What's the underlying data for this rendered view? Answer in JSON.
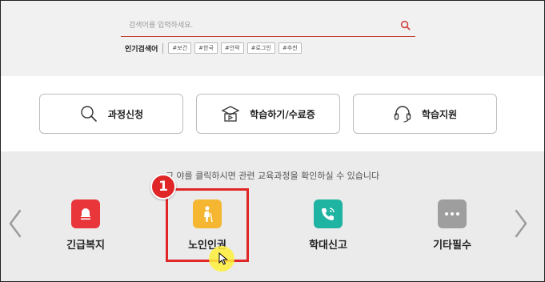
{
  "search": {
    "placeholder": "검색어를 입력하세요.",
    "popular_label": "인기검색어",
    "tags": [
      "#보건",
      "#한국",
      "#안락",
      "#로그인",
      "#추천"
    ]
  },
  "quick_menu": [
    {
      "label": "과정신청",
      "icon": "search-icon"
    },
    {
      "label": "학습하기/수료증",
      "icon": "graduation-icon"
    },
    {
      "label": "학습지원",
      "icon": "headset-icon"
    }
  ],
  "categories": {
    "note": "고 야를 클릭하시면 관련 교육과정을 확인하실 수 있습니다",
    "items": [
      {
        "label": "긴급복지",
        "icon": "bell-icon",
        "color": "#e8363a"
      },
      {
        "label": "노인인권",
        "icon": "elderly-icon",
        "color": "#f5b731"
      },
      {
        "label": "학대신고",
        "icon": "phone-icon",
        "color": "#1fb3a1"
      },
      {
        "label": "기타필수",
        "icon": "more-icon",
        "color": "#9e9e9e"
      }
    ]
  },
  "annotation": {
    "step": "1"
  },
  "colors": {
    "accent": "#e02626",
    "search_underline": "#c0392b"
  }
}
